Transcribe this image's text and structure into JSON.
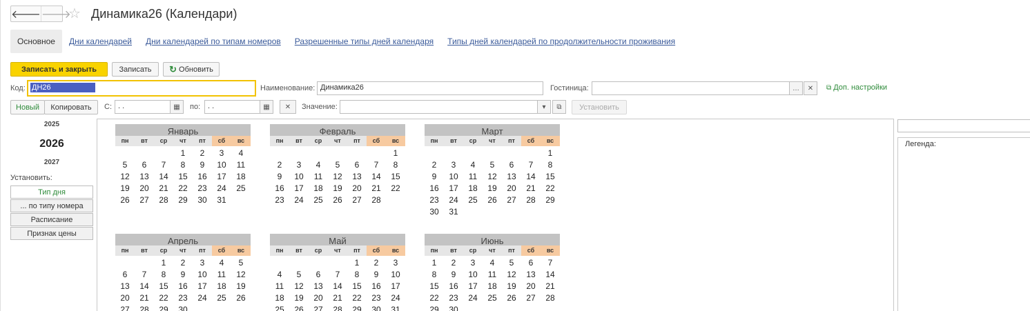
{
  "window": {
    "title": "Динамика26 (Календари)"
  },
  "nav": {
    "back": "🡐",
    "forward": "🡒",
    "star": "☆"
  },
  "tabs": [
    {
      "label": "Основное"
    },
    {
      "label": "Дни календарей"
    },
    {
      "label": "Дни календарей по типам номеров"
    },
    {
      "label": "Разрешенные типы дней календаря"
    },
    {
      "label": "Типы дней календарей по продолжительности проживания"
    }
  ],
  "toolbar": {
    "save_close": "Записать и закрыть",
    "save": "Записать",
    "refresh": "Обновить"
  },
  "form": {
    "code_label": "Код:",
    "code_value": "ДН26",
    "name_label": "Наименование:",
    "name_value": "Динамика26",
    "hotel_label": "Гостиница:",
    "hotel_value": "",
    "extra_settings": "Доп. настройки"
  },
  "filter": {
    "new": "Новый",
    "copy": "Копировать",
    "from_label": "С:",
    "from_value": ". .",
    "to_label": "по:",
    "to_value": ". .",
    "value_label": "Значение:",
    "value_value": "",
    "set": "Установить"
  },
  "years": {
    "prev": "2025",
    "current": "2026",
    "next": "2027"
  },
  "set_panel": {
    "label": "Установить:",
    "buttons": [
      "Тип дня",
      "... по типу номера",
      "Расписание",
      "Признак цены"
    ]
  },
  "legend": {
    "label": "Легенда:"
  },
  "calendar": {
    "weekdays": [
      "пн",
      "вт",
      "ср",
      "чт",
      "пт",
      "сб",
      "вс"
    ],
    "months": [
      {
        "name": "Январь",
        "offset": 3,
        "days": 31
      },
      {
        "name": "Февраль",
        "offset": 6,
        "days": 28
      },
      {
        "name": "Март",
        "offset": 6,
        "days": 31
      },
      {
        "name": "Апрель",
        "offset": 2,
        "days": 30
      },
      {
        "name": "Май",
        "offset": 4,
        "days": 31
      },
      {
        "name": "Июнь",
        "offset": 0,
        "days": 30
      }
    ]
  },
  "colors": {
    "primary": "#f9d300",
    "weekend": "#f7caa0",
    "link": "#3a5a9a",
    "green": "#2e8b3a"
  }
}
